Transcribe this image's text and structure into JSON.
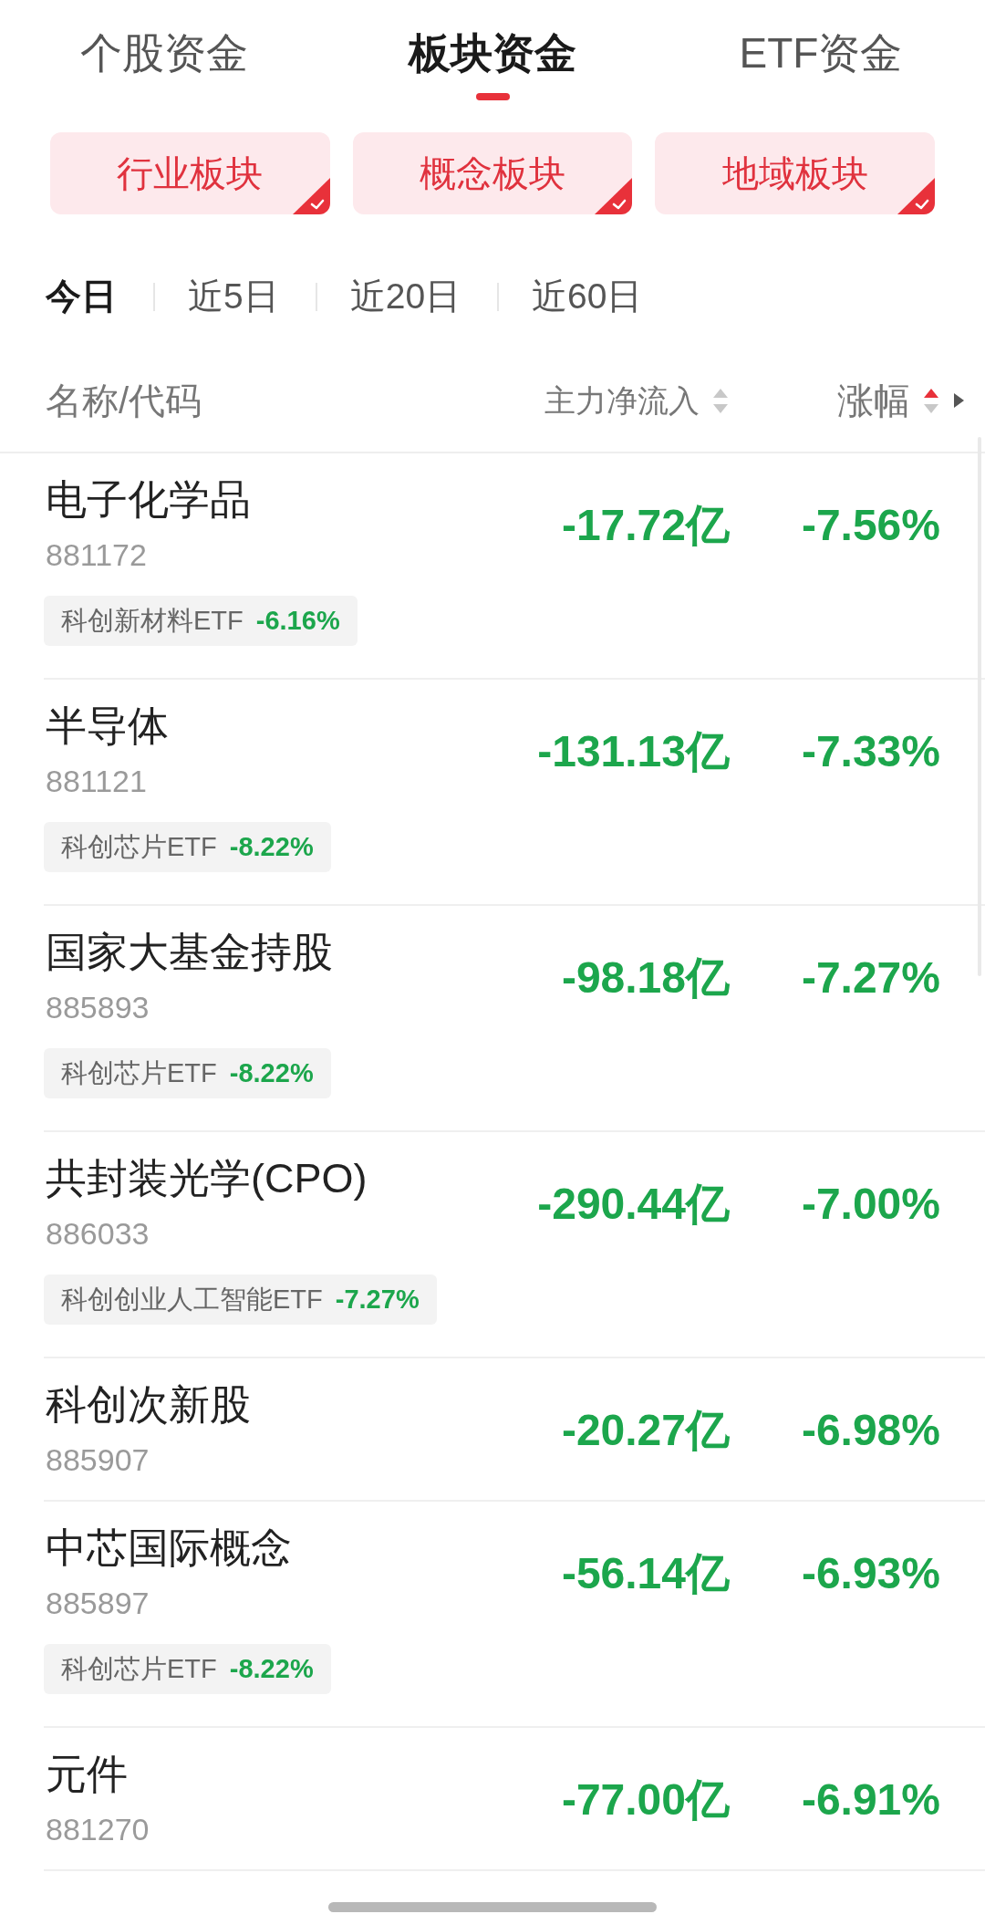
{
  "top_tabs": [
    {
      "label": "个股资金",
      "selected": false
    },
    {
      "label": "板块资金",
      "selected": true
    },
    {
      "label": "ETF资金",
      "selected": false
    }
  ],
  "categories": [
    {
      "label": "行业板块",
      "checked": true
    },
    {
      "label": "概念板块",
      "checked": true
    },
    {
      "label": "地域板块",
      "checked": true
    }
  ],
  "periods": [
    {
      "label": "今日",
      "selected": true
    },
    {
      "label": "近5日",
      "selected": false
    },
    {
      "label": "近20日",
      "selected": false
    },
    {
      "label": "近60日",
      "selected": false
    }
  ],
  "table": {
    "columns": [
      {
        "label": "名称/代码",
        "sortable": false
      },
      {
        "label": "主力净流入",
        "sortable": true,
        "sorted_up": false,
        "sorted_down": false
      },
      {
        "label": "涨幅",
        "sortable": true,
        "sorted_up": true,
        "sorted_down": false
      }
    ],
    "rows": [
      {
        "name": "电子化学品",
        "code": "881172",
        "net_inflow": "-17.72亿",
        "change": "-7.56%",
        "falling": true,
        "etf": {
          "name": "科创新材料ETF",
          "change": "-6.16%",
          "falling": true
        }
      },
      {
        "name": "半导体",
        "code": "881121",
        "net_inflow": "-131.13亿",
        "change": "-7.33%",
        "falling": true,
        "etf": {
          "name": "科创芯片ETF",
          "change": "-8.22%",
          "falling": true
        }
      },
      {
        "name": "国家大基金持股",
        "code": "885893",
        "net_inflow": "-98.18亿",
        "change": "-7.27%",
        "falling": true,
        "etf": {
          "name": "科创芯片ETF",
          "change": "-8.22%",
          "falling": true
        }
      },
      {
        "name": "共封装光学(CPO)",
        "code": "886033",
        "net_inflow": "-290.44亿",
        "change": "-7.00%",
        "falling": true,
        "etf": {
          "name": "科创创业人工智能ETF",
          "change": "-7.27%",
          "falling": true
        }
      },
      {
        "name": "科创次新股",
        "code": "885907",
        "net_inflow": "-20.27亿",
        "change": "-6.98%",
        "falling": true
      },
      {
        "name": "中芯国际概念",
        "code": "885897",
        "net_inflow": "-56.14亿",
        "change": "-6.93%",
        "falling": true,
        "etf": {
          "name": "科创芯片ETF",
          "change": "-8.22%",
          "falling": true
        }
      },
      {
        "name": "元件",
        "code": "881270",
        "net_inflow": "-77.00亿",
        "change": "-6.91%",
        "falling": true
      }
    ]
  }
}
